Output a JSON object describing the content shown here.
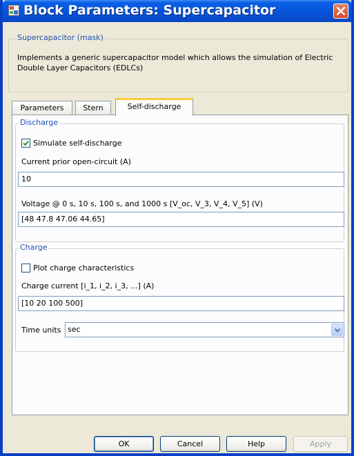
{
  "window": {
    "title": "Block Parameters: Supercapacitor",
    "icon": "simulink-block-icon",
    "close_icon": "close-x-icon"
  },
  "mask": {
    "legend": "Supercapacitor (mask)",
    "description_line1": "Implements a generic supercapacitor model which allows the simulation of Electric",
    "description_line2": "Double Layer Capacitors (EDLCs)"
  },
  "tabs": [
    {
      "label": "Parameters",
      "active": false
    },
    {
      "label": "Stern",
      "active": false
    },
    {
      "label": "Self-discharge",
      "active": true
    }
  ],
  "discharge": {
    "legend": "Discharge",
    "simulate_checkbox": {
      "label": "Simulate self-discharge",
      "checked": true
    },
    "current_label": "Current prior open-circuit (A)",
    "current_value": "10",
    "voltage_label": "Voltage @ 0 s, 10 s, 100 s, and 1000 s  [V_oc, V_3, V_4, V_5] (V)",
    "voltage_value": "[48 47.8 47.06 44.65]"
  },
  "charge": {
    "legend": "Charge",
    "plot_checkbox": {
      "label": "Plot charge characteristics",
      "checked": false
    },
    "current_label": "Charge current [i_1, i_2, i_3, ...] (A)",
    "current_value": "[10 20 100 500]",
    "time_units_label": "Time units",
    "time_units_value": "sec"
  },
  "buttons": {
    "ok": "OK",
    "cancel": "Cancel",
    "help": "Help",
    "apply": "Apply"
  },
  "colors": {
    "titlebar": "#0654d9",
    "dialog_bg": "#ece9d8",
    "legend_text": "#1e50b4",
    "active_tab_accent": "#ffc83c"
  }
}
